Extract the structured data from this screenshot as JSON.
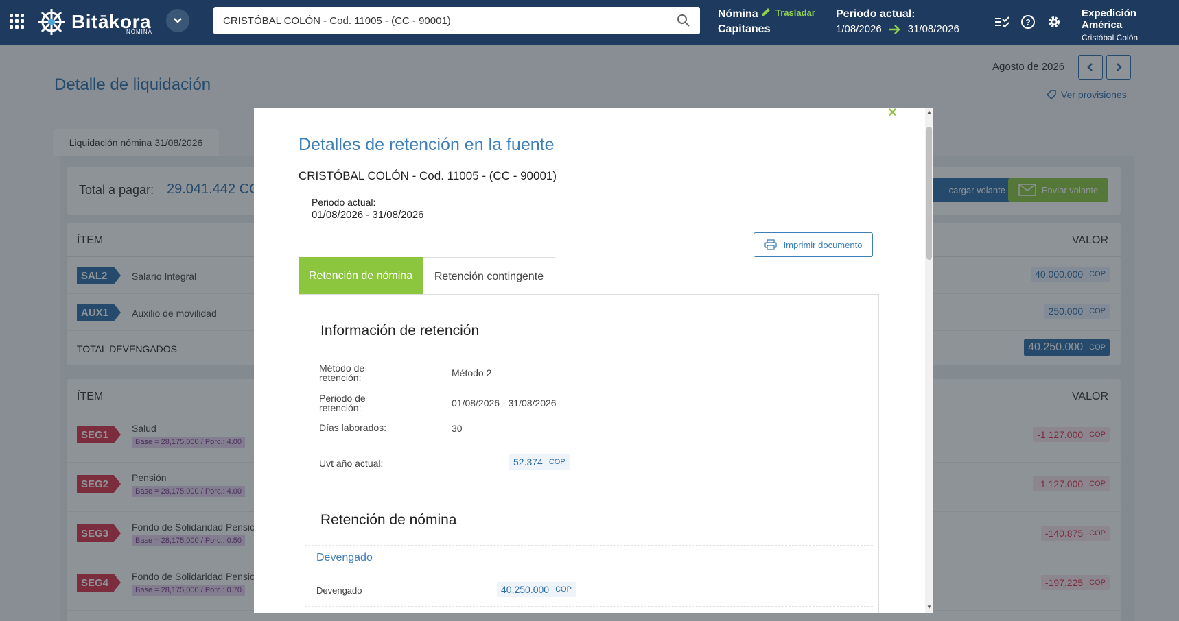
{
  "header": {
    "brand": "Bitākora",
    "brand_sub": "NÓMINA",
    "search_value": "CRISTÓBAL COLÓN - Cod. 11005 - (CC - 90001)",
    "nomina_label": "Nómina",
    "nomina_name": "Capitanes",
    "trasladar": "Trasladar",
    "periodo_label": "Periodo actual:",
    "periodo_start": "1/08/2026",
    "periodo_end": "31/08/2026",
    "company_name": "Expedición América",
    "user_name": "Cristóbal Colón"
  },
  "page": {
    "title": "Detalle de liquidación",
    "month": "Agosto de 2026",
    "ver_provisiones": "Ver provisiones",
    "tab": "Liquidación nómina 31/08/2026",
    "total_label": "Total a pagar:",
    "total_value": "29.041.442",
    "total_cur": "CO",
    "btn_descargar": "cargar volante",
    "btn_enviar": "Enviar volante",
    "col_item": "ÍTEM",
    "col_valor": "VALOR",
    "devengos": [
      {
        "code": "SAL2",
        "name": "Salario Integral",
        "value": "40.000.000",
        "cur": "COP"
      },
      {
        "code": "AUX1",
        "name": "Auxilio de movilidad",
        "value": "250.000",
        "cur": "COP"
      }
    ],
    "total_devengados_label": "TOTAL DEVENGADOS",
    "total_devengados_value": "40.250.000",
    "total_devengados_cur": "COP",
    "deducciones": [
      {
        "code": "SEG1",
        "name": "Salud",
        "base": "Base = 28,175,000 / Porc.: 4.00",
        "value": "-1.127.000",
        "cur": "COP"
      },
      {
        "code": "SEG2",
        "name": "Pensión",
        "base": "Base = 28,175,000 / Porc.: 4.00",
        "value": "-1.127.000",
        "cur": "COP"
      },
      {
        "code": "SEG3",
        "name": "Fondo de Solidaridad Pensic",
        "base": "Base = 28,175,000 / Porc.: 0.50",
        "value": "-140.875",
        "cur": "COP"
      },
      {
        "code": "SEG4",
        "name": "Fondo de Solidaridad Pensic",
        "base": "Base = 28,175,000 / Porc.: 0.70",
        "value": "-197.225",
        "cur": "COP"
      }
    ]
  },
  "modal": {
    "title": "Detalles de retención en la fuente",
    "employee": "CRISTÓBAL COLÓN - Cod. 11005 - (CC - 90001)",
    "periodo_label": "Periodo actual:",
    "periodo_value": "01/08/2026 - 31/08/2026",
    "print_button": "Imprimir documento",
    "tab_nomina": "Retención de nómina",
    "tab_contingente": "Retención contingente",
    "info_heading": "Información de retención",
    "metodo_label": "Método de retención:",
    "metodo_value": "Método 2",
    "periodo_ret_label": "Periodo de retención:",
    "periodo_ret_value": "01/08/2026 - 31/08/2026",
    "dias_label": "Días laborados:",
    "dias_value": "30",
    "uvt_label": "Uvt año actual:",
    "uvt_value": "52.374",
    "uvt_cur": "COP",
    "ret_heading": "Retención de nómina",
    "devengado_heading": "Devengado",
    "devengado_label": "Devengado",
    "devengado_value": "40.250.000",
    "devengado_cur": "COP"
  },
  "colors": {
    "navy": "#1e3a5f",
    "blue": "#2e6da4",
    "green": "#8cc63f",
    "red": "#d9324b"
  }
}
